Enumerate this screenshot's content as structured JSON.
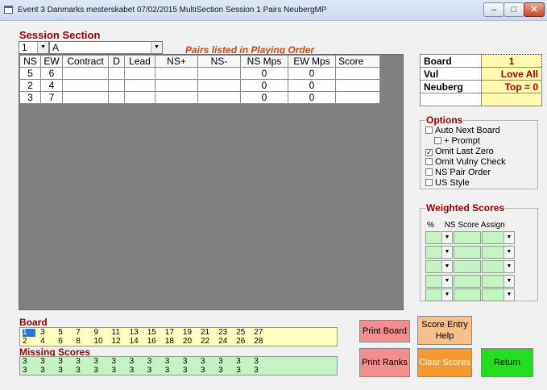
{
  "window": {
    "title": "Event 3   Danmarks mesterskabet 07/02/2015 MultiSection Session 1 Pairs NeubergMP",
    "min_glyph": "–",
    "max_glyph": "□",
    "close_glyph": "✕"
  },
  "session": {
    "label": "Session Section",
    "session_value": "1",
    "section_value": "A",
    "arrow": "▼"
  },
  "pairs_order_label": "Pairs listed in Playing Order",
  "score_table": {
    "headers": [
      "NS",
      "EW",
      "Contract",
      "D",
      "Lead",
      "NS+",
      "NS-",
      "NS Mps",
      "EW Mps",
      "Score"
    ],
    "rows": [
      [
        "5",
        "6",
        "",
        "",
        "",
        "",
        "",
        "0",
        "0",
        ""
      ],
      [
        "2",
        "4",
        "",
        "",
        "",
        "",
        "",
        "0",
        "0",
        ""
      ],
      [
        "3",
        "7",
        "",
        "",
        "",
        "",
        "",
        "0",
        "0",
        ""
      ]
    ]
  },
  "info_panel": {
    "board_label": "Board",
    "board_value": "1",
    "vul_label": "Vul",
    "vul_value": "Love All",
    "scoring_label": "Neuberg",
    "scoring_value": "Top = 0"
  },
  "options": {
    "legend": "Options",
    "items": [
      {
        "label": "Auto Next Board",
        "checked": false
      },
      {
        "label": "+ Prompt",
        "checked": false
      },
      {
        "label": "Omit Last Zero",
        "checked": true
      },
      {
        "label": "Omit Vulny Check",
        "checked": false
      },
      {
        "label": "NS Pair Order",
        "checked": false
      },
      {
        "label": "US Style",
        "checked": false
      }
    ]
  },
  "weighted_scores": {
    "legend": "Weighted Scores",
    "col_pct": "%",
    "col_ns_score": "NS Score",
    "col_assign": "Assign",
    "rows": 5
  },
  "boards": {
    "label": "Board",
    "row1": [
      "1",
      "3",
      "5",
      "7",
      "9",
      "11",
      "13",
      "15",
      "17",
      "19",
      "21",
      "23",
      "25",
      "27"
    ],
    "row2": [
      "2",
      "4",
      "6",
      "8",
      "10",
      "12",
      "14",
      "16",
      "18",
      "20",
      "22",
      "24",
      "26",
      "28"
    ],
    "selected": "1"
  },
  "missing_scores": {
    "label": "Missing Scores",
    "row1": [
      "3",
      "3",
      "3",
      "3",
      "3",
      "3",
      "3",
      "3",
      "3",
      "3",
      "3",
      "3",
      "3",
      "3"
    ],
    "row2": [
      "3",
      "3",
      "3",
      "3",
      "3",
      "3",
      "3",
      "3",
      "3",
      "3",
      "3",
      "3",
      "3",
      "3"
    ]
  },
  "buttons": {
    "print_board": "Print Board",
    "score_entry_help": "Score Entry Help",
    "print_ranks": "Print Ranks",
    "clear_scores": "Clear Scores",
    "return": "Return"
  },
  "colors": {
    "label_red": "#a00000",
    "pairs_order_orange": "#d04a10",
    "grid_gray": "#808080",
    "board_yellow": "#ffffc0",
    "missing_green": "#c4f4c4",
    "return_green": "#22dd22"
  }
}
